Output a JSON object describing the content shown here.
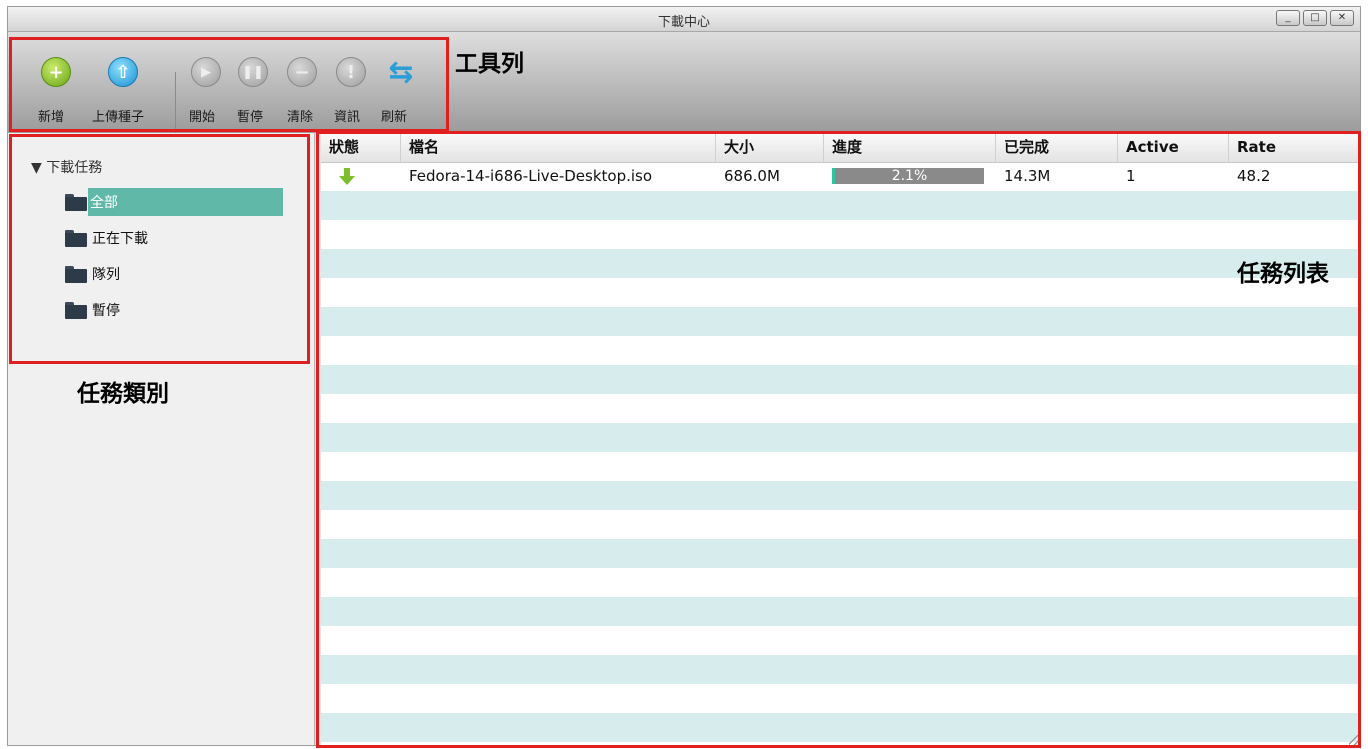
{
  "window": {
    "title": "下載中心",
    "controls": {
      "minimize": "_",
      "maximize": "□",
      "close": "✕"
    }
  },
  "toolbar": {
    "buttons": [
      {
        "label": "新增",
        "icon": "add-icon"
      },
      {
        "label": "上傳種子",
        "icon": "upload-icon"
      },
      {
        "label": "開始",
        "icon": "play-icon"
      },
      {
        "label": "暫停",
        "icon": "pause-icon"
      },
      {
        "label": "清除",
        "icon": "remove-icon"
      },
      {
        "label": "資訊",
        "icon": "info-icon"
      },
      {
        "label": "刷新",
        "icon": "refresh-icon"
      }
    ]
  },
  "annotations": {
    "toolbar": "工具列",
    "category": "任務類別",
    "tasklist": "任務列表"
  },
  "sidebar": {
    "root": "▼ 下載任務",
    "items": [
      {
        "label": "全部",
        "selected": true
      },
      {
        "label": "正在下載",
        "selected": false
      },
      {
        "label": "隊列",
        "selected": false
      },
      {
        "label": "暫停",
        "selected": false
      }
    ]
  },
  "tasklist": {
    "columns": [
      "狀態",
      "檔名",
      "大小",
      "進度",
      "已完成",
      "Active",
      "Rate"
    ],
    "rows": [
      {
        "status_icon": "download-arrow-icon",
        "filename": "Fedora-14-i686-Live-Desktop.iso",
        "size": "686.0M",
        "progress": 2.1,
        "progress_label": "2.1%",
        "completed": "14.3M",
        "active": "1",
        "rate": "48.2"
      }
    ]
  },
  "colors": {
    "annotation": "#e02020",
    "row_alt": "#d7ecec",
    "selected": "#5fb8a8",
    "progress_fill": "#2ec4a0"
  }
}
